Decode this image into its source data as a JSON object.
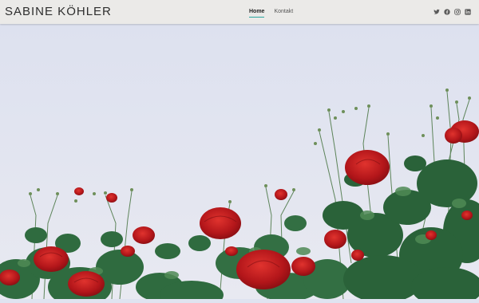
{
  "header": {
    "brand": "SABINE KÖHLER",
    "nav": [
      {
        "label": "Home",
        "active": true
      },
      {
        "label": "Kontakt",
        "active": false
      }
    ],
    "social": [
      {
        "icon": "twitter-icon"
      },
      {
        "icon": "facebook-icon"
      },
      {
        "icon": "instagram-icon"
      },
      {
        "icon": "linkedin-icon"
      }
    ]
  },
  "hero": {
    "image": "rose-bush-photo",
    "colors": {
      "sky_top": "#dfe3f0",
      "sky_bottom": "#e7e9f1",
      "leaf": "#2f6b3f",
      "rose": "#b71a1c"
    }
  }
}
